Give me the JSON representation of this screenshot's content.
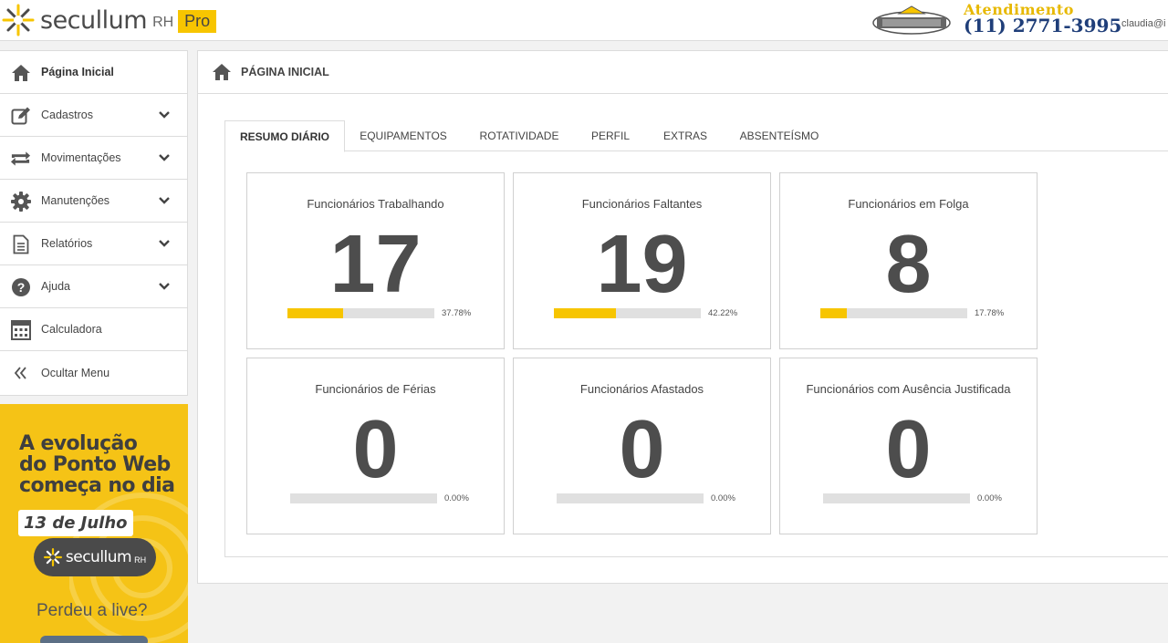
{
  "header": {
    "brand_name": "secullum",
    "brand_rh": "RH",
    "brand_pro": "Pro",
    "atendimento": "Atendimento",
    "phone": "(11) 2771-3995",
    "user": "claudia@i"
  },
  "sidebar": {
    "items": [
      {
        "label": "Página Inicial",
        "icon": "home-icon"
      },
      {
        "label": "Cadastros",
        "icon": "edit-icon"
      },
      {
        "label": "Movimentações",
        "icon": "sync-icon"
      },
      {
        "label": "Manutenções",
        "icon": "gear-icon"
      },
      {
        "label": "Relatórios",
        "icon": "document-icon"
      },
      {
        "label": "Ajuda",
        "icon": "help-icon"
      },
      {
        "label": "Calculadora",
        "icon": "calculator-icon"
      },
      {
        "label": "Ocultar Menu",
        "icon": "double-chevron-left-icon"
      }
    ]
  },
  "banner": {
    "line1": "A evolução",
    "line2": "do Ponto Web",
    "line3": "começa no dia",
    "date": "13 de Julho",
    "brand": "secullum",
    "brand_rh": "RH",
    "cta": "Perdeu a live?"
  },
  "main": {
    "title": "PÁGINA INICIAL",
    "tabs": [
      {
        "label": "RESUMO DIÁRIO",
        "active": true
      },
      {
        "label": "EQUIPAMENTOS"
      },
      {
        "label": "ROTATIVIDADE"
      },
      {
        "label": "PERFIL"
      },
      {
        "label": "EXTRAS"
      },
      {
        "label": "ABSENTEÍSMO"
      }
    ],
    "cards": [
      {
        "title": "Funcionários Trabalhando",
        "value": "17",
        "percent_label": "37.78%",
        "percent": 37.78
      },
      {
        "title": "Funcionários Faltantes",
        "value": "19",
        "percent_label": "42.22%",
        "percent": 42.22
      },
      {
        "title": "Funcionários em Folga",
        "value": "8",
        "percent_label": "17.78%",
        "percent": 17.78
      },
      {
        "title": "Funcionários de Férias",
        "value": "0",
        "percent_label": "0.00%",
        "percent": 0
      },
      {
        "title": "Funcionários Afastados",
        "value": "0",
        "percent_label": "0.00%",
        "percent": 0
      },
      {
        "title": "Funcionários com Ausência Justificada",
        "value": "0",
        "percent_label": "0.00%",
        "percent": 0
      }
    ]
  },
  "colors": {
    "accent": "#f7c500",
    "phone": "#1f3e79",
    "atendimento": "#e7b800"
  }
}
